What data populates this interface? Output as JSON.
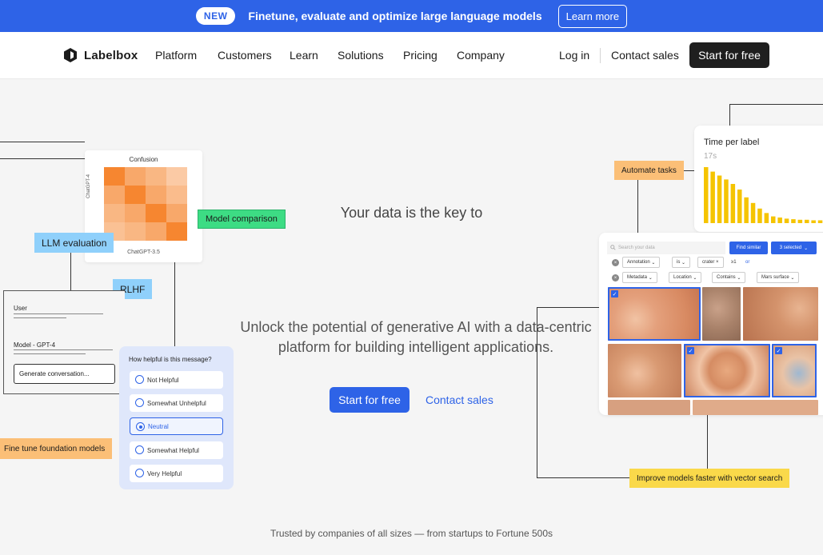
{
  "banner": {
    "badge": "NEW",
    "text": "Finetune, evaluate and optimize large language models",
    "cta": "Learn more"
  },
  "nav": {
    "brand": "Labelbox",
    "links": [
      "Platform",
      "Customers",
      "Learn",
      "Solutions",
      "Pricing",
      "Company"
    ],
    "login": "Log in",
    "contact": "Contact sales",
    "start": "Start for free"
  },
  "hero": {
    "title": "Your data is the key to",
    "subtitle": "Unlock the potential of generative AI with a data-centric platform for building intelligent applications.",
    "start": "Start for free",
    "contact": "Contact sales",
    "trusted": "Trusted by companies of all sizes — from startups to Fortune 500s"
  },
  "tags": {
    "model_comparison": "Model comparison",
    "llm_evaluation": "LLM evaluation",
    "rlhf": "RLHF",
    "fine_tune": "Fine tune foundation models",
    "automate": "Automate tasks",
    "vector_search": "Improve models faster with vector search"
  },
  "tag_colors": {
    "model_comparison": "#3ddc84",
    "llm_evaluation": "#8fd0fb",
    "rlhf": "#8fd0fb",
    "fine_tune": "#fbbf77",
    "automate": "#fbbf77",
    "vector_search": "#fad94a"
  },
  "confusion": {
    "title": "Confusion",
    "ylabel": "ChatGPT-4",
    "xlabel": "ChatGPT-3.5",
    "matrix": [
      [
        0.9,
        0.55,
        0.4,
        0.2
      ],
      [
        0.55,
        0.9,
        0.55,
        0.35
      ],
      [
        0.4,
        0.55,
        0.9,
        0.55
      ],
      [
        0.3,
        0.4,
        0.55,
        0.9
      ]
    ]
  },
  "chat": {
    "user_label": "User",
    "model_label": "Model - GPT-4",
    "generate": "Generate conversation..."
  },
  "helpful": {
    "question": "How helpful is this message?",
    "options": [
      "Not Helpful",
      "Somewhat Unhelpful",
      "Neutral",
      "Somewhat Helpful",
      "Very Helpful"
    ],
    "selected": "Neutral"
  },
  "time_per_label": {
    "title": "Time per label",
    "value": "17s",
    "bar_color": "#f5c400",
    "bars": [
      1.0,
      0.92,
      0.85,
      0.78,
      0.7,
      0.6,
      0.46,
      0.36,
      0.26,
      0.18,
      0.12,
      0.1,
      0.08,
      0.07,
      0.06,
      0.06,
      0.05,
      0.05,
      0.04
    ]
  },
  "search_panel": {
    "placeholder": "Search your data",
    "find_similar": "Find similar",
    "selected_count": "3 selected",
    "filter1": [
      "Annotation",
      "is",
      "crater",
      "≥1",
      "or"
    ],
    "filter2": [
      "Metadata",
      "Location",
      "Contains",
      "Mars surface"
    ]
  },
  "colors": {
    "accent": "#2e63e7",
    "background": "#f5f5f5"
  }
}
